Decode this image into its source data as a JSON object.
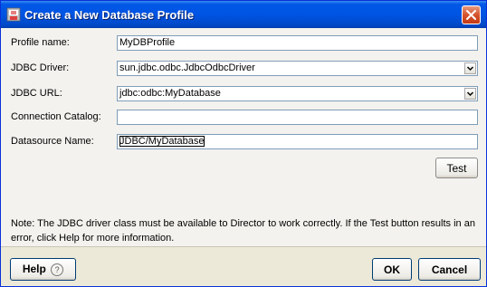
{
  "window": {
    "title": "Create a New Database Profile"
  },
  "form": {
    "profile_name": {
      "label": "Profile name:",
      "value": "MyDBProfile"
    },
    "jdbc_driver": {
      "label": "JDBC Driver:",
      "value": "sun.jdbc.odbc.JdbcOdbcDriver"
    },
    "jdbc_url": {
      "label": "JDBC URL:",
      "value": "jdbc:odbc:MyDatabase"
    },
    "connection_catalog": {
      "label": "Connection Catalog:",
      "value": ""
    },
    "datasource_name": {
      "label": "Datasource Name:",
      "value": "JDBC/MyDatabase"
    }
  },
  "test_button": {
    "label": "Test"
  },
  "note": "Note: The JDBC driver class must be available to Director to work correctly. If the Test button results in an error, click Help for more information.",
  "footer": {
    "help_label": "Help",
    "ok_label": "OK",
    "cancel_label": "Cancel"
  },
  "icons": {
    "title": "database-profile-icon",
    "close": "close-icon",
    "dropdown": "chevron-down-icon",
    "help": "question-circle-icon"
  },
  "colors": {
    "titlebar": "#0054E3",
    "close": "#D5532D",
    "field_border": "#7F9DB9",
    "dialog_bg": "#F3F2EE"
  }
}
